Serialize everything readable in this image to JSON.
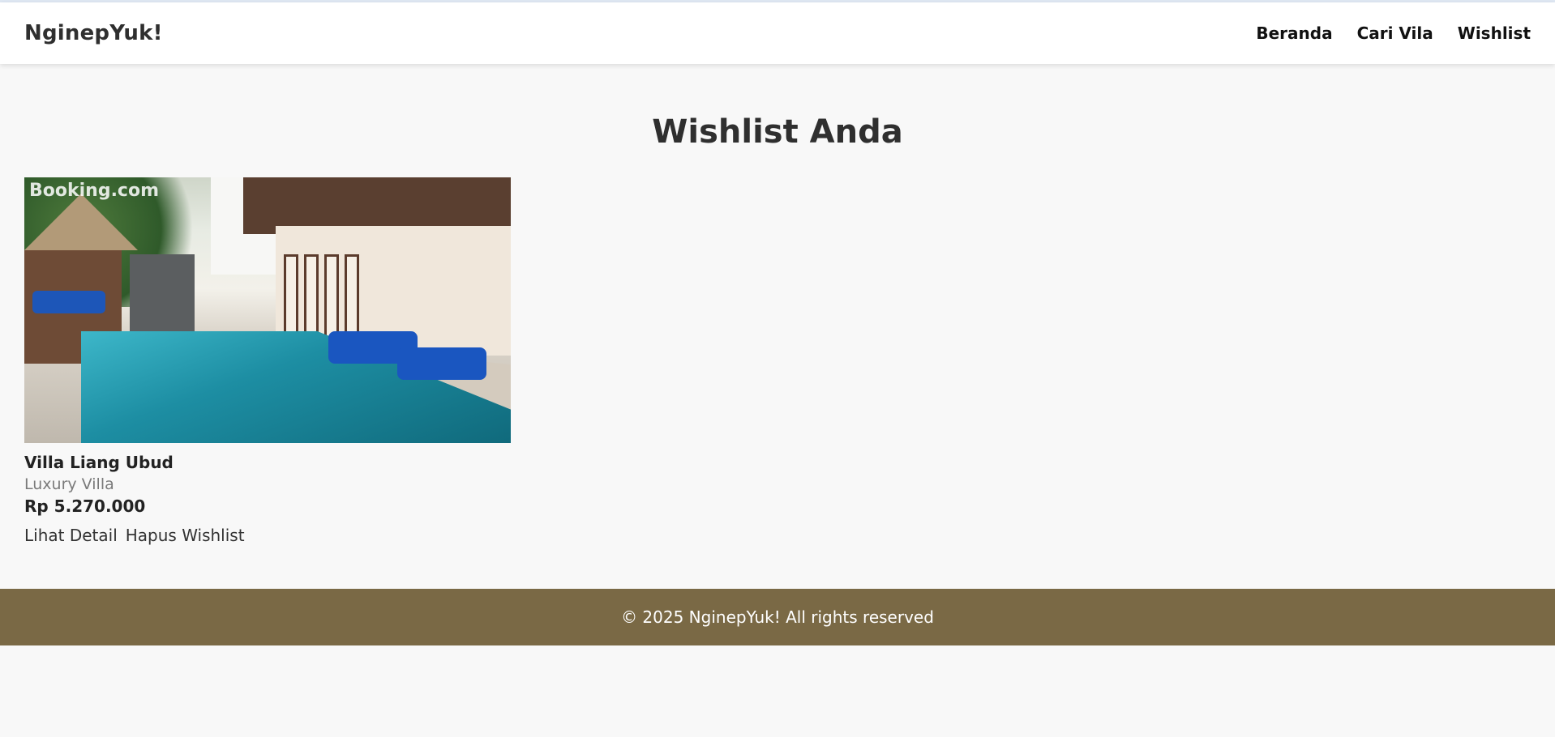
{
  "brand": "NginepYuk!",
  "nav": {
    "items": [
      "Beranda",
      "Cari Vila",
      "Wishlist"
    ]
  },
  "page": {
    "title": "Wishlist Anda"
  },
  "wishlist": [
    {
      "name": "Villa Liang Ubud",
      "type": "Luxury Villa",
      "price": "Rp 5.270.000",
      "image_watermark": "Booking.com",
      "actions": {
        "detail": "Lihat Detail",
        "remove": "Hapus Wishlist"
      }
    }
  ],
  "footer": {
    "text": "© 2025 NginepYuk! All rights reserved"
  },
  "colors": {
    "footer_bg": "#7a6945",
    "page_bg": "#f8f8f8"
  }
}
